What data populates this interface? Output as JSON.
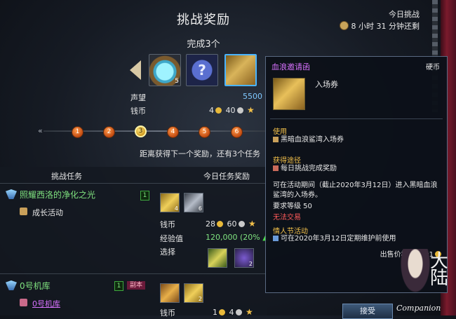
{
  "header": {
    "title": "挑战奖励",
    "daily_label": "今日挑战",
    "daily_timer": "8 小时 31 分钟还剩"
  },
  "reward_box": {
    "complete_text": "完成3个",
    "slots": [
      {
        "icon": "crystal-orb-icon",
        "count": "5"
      },
      {
        "icon": "mystery-box-icon",
        "symbol": "?"
      },
      {
        "icon": "invitation-letter-icon"
      }
    ],
    "reputation_label": "声望",
    "reputation_value": "5500",
    "coin_label": "钱币",
    "coin_gold": "4",
    "coin_silver": "40"
  },
  "progress": {
    "nodes": [
      "1",
      "2",
      "3",
      "4",
      "5",
      "6"
    ],
    "current_node": 3,
    "next_reward_text": "距离获得下一个奖励，还有3个任务"
  },
  "tabs": {
    "tasks": "挑战任务",
    "today": "今日任务奖励"
  },
  "tasks": [
    {
      "title": "照耀西洛的净化之光",
      "subtitle": "成长活动",
      "count": "1",
      "rewards": [
        {
          "icon": "gold-bag-icon",
          "count": "4"
        },
        {
          "icon": "silver-key-icon",
          "count": "6"
        }
      ],
      "coin_label": "钱币",
      "coin_gold": "28",
      "coin_silver": "60",
      "exp_label": "经验值",
      "exp_value": "120,000 (20%",
      "select_label": "选择",
      "select_items": [
        {
          "icon": "scroll-icon",
          "count": ""
        },
        {
          "icon": "purple-orb-icon",
          "count": "2"
        }
      ]
    },
    {
      "title": "0号机库",
      "subtitle": "0号机库",
      "count": "1",
      "badge": "副本",
      "rewards": [
        {
          "icon": "treasure-chest-icon",
          "count": ""
        },
        {
          "icon": "gold-shard-icon",
          "count": "2"
        }
      ],
      "coin_label": "钱币",
      "coin_gold": "1",
      "coin_silver": "4"
    }
  ],
  "accept_label": "接受",
  "tooltip": {
    "name": "血浪邀请函",
    "type": "硬币",
    "icon_name": "入场券",
    "use_head": "使用",
    "use_text": "黑暗血浪鲨湾入场券",
    "obtain_head": "获得途径",
    "obtain_text": "每日挑战完成奖励",
    "desc": "可在活动期间（截止2020年3月12日）进入黑暗血浪鲨湾的入场券。",
    "level_text": "要求等级 50",
    "trade_text": "无法交易",
    "festival_head": "情人节活动",
    "festival_text": "可在2020年3月12日定期维护前使用",
    "sell_text": "出售价格为每个1"
  },
  "companion": {
    "glyph": "大陆",
    "label": "Companion"
  },
  "colors": {
    "task_green": "#7fe27f",
    "tooltip_purple": "#d872ff",
    "heading_gold": "#f2c04a",
    "warning_red": "#ff5a5a",
    "reputation_blue": "#7fc8ff"
  }
}
